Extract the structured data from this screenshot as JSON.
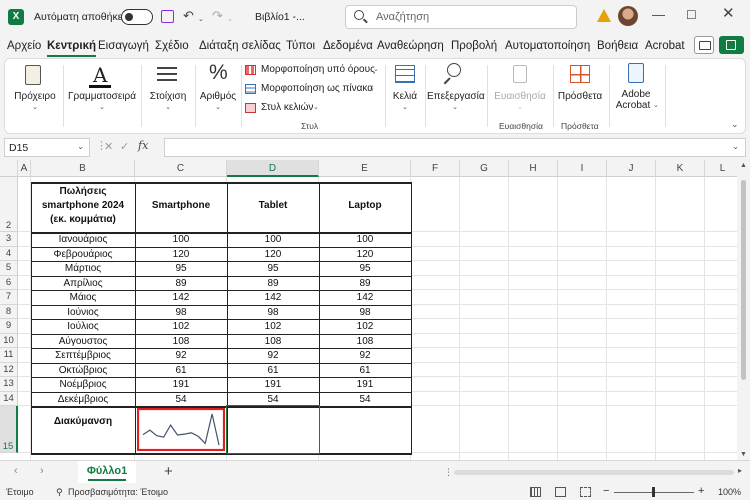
{
  "titlebar": {
    "autosave_label": "Αυτόματη αποθήκευση",
    "doc_title": "Βιβλίο1 -...",
    "search_placeholder": "Αναζήτηση",
    "app_icon_letter": "X"
  },
  "menu": {
    "tabs": [
      "Αρχείο",
      "Κεντρική",
      "Εισαγωγή",
      "Σχέδιο",
      "Διάταξη σελίδας",
      "Τύποι",
      "Δεδομένα",
      "Αναθεώρηση",
      "Προβολή",
      "Αυτοματοποίηση",
      "Βοήθεια",
      "Acrobat"
    ],
    "active": "Κεντρική"
  },
  "ribbon": {
    "paste": "Πρόχειρο",
    "font": "Γραμματοσειρά",
    "alignment": "Στοίχιση",
    "number": "Αριθμός",
    "number_symbol": "%",
    "conditional": "Μορφοποίηση υπό όρους",
    "as_table": "Μορφοποίηση ως πίνακα",
    "cell_styles": "Στυλ κελιών",
    "styles_group": "Στυλ",
    "cells": "Κελιά",
    "editing": "Επεξεργασία",
    "sensitivity": "Ευαισθησία",
    "sensitivity_group": "Ευαισθησία",
    "addins": "Πρόσθετα",
    "addins_group": "Πρόσθετα",
    "adobe_line1": "Adobe",
    "adobe_line2": "Acrobat"
  },
  "formula_bar": {
    "name_box": "D15",
    "fx": "fx",
    "formula": ""
  },
  "grid": {
    "columns": [
      "A",
      "B",
      "C",
      "D",
      "E",
      "F",
      "G",
      "H",
      "I",
      "J",
      "K",
      "L"
    ],
    "rows": [
      "2",
      "3",
      "4",
      "5",
      "6",
      "7",
      "8",
      "9",
      "10",
      "11",
      "12",
      "13",
      "14",
      "15"
    ],
    "selected_col": "D",
    "selected_row": "15"
  },
  "table": {
    "header_b": "Πωλήσεις smartphone 2024 (εκ. κομμάτια)",
    "headers": [
      "Smartphone",
      "Tablet",
      "Laptop"
    ],
    "months": [
      "Ιανουάριος",
      "Φεβρουάριος",
      "Μάρτιος",
      "Απρίλιος",
      "Μάιος",
      "Ιούνιος",
      "Ιούλιος",
      "Αύγουστος",
      "Σεπτέμβριος",
      "Οκτώβριος",
      "Νοέμβριος",
      "Δεκέμβριος"
    ],
    "smartphone": [
      "100",
      "120",
      "95",
      "89",
      "142",
      "98",
      "102",
      "108",
      "92",
      "61",
      "191",
      "54"
    ],
    "tablet": [
      "100",
      "120",
      "95",
      "89",
      "142",
      "98",
      "102",
      "108",
      "92",
      "61",
      "191",
      "54"
    ],
    "laptop": [
      "100",
      "120",
      "95",
      "89",
      "142",
      "98",
      "102",
      "108",
      "92",
      "61",
      "191",
      "54"
    ],
    "variance_label": "Διακύμανση"
  },
  "sparkline": {
    "values": [
      100,
      120,
      95,
      89,
      142,
      98,
      102,
      108,
      92,
      61,
      191,
      54
    ],
    "line_color": "#44546a",
    "highlight_color": "#e02020"
  },
  "sheets": {
    "tabs": [
      "Φύλλο1"
    ],
    "add": "+"
  },
  "status": {
    "ready": "Έτοιμο",
    "accessibility": "Προσβασιμότητα: Έτοιμο",
    "zoom": "100%",
    "zoom_minus": "−",
    "zoom_plus": "+"
  },
  "colors": {
    "accent": "#107c41"
  }
}
